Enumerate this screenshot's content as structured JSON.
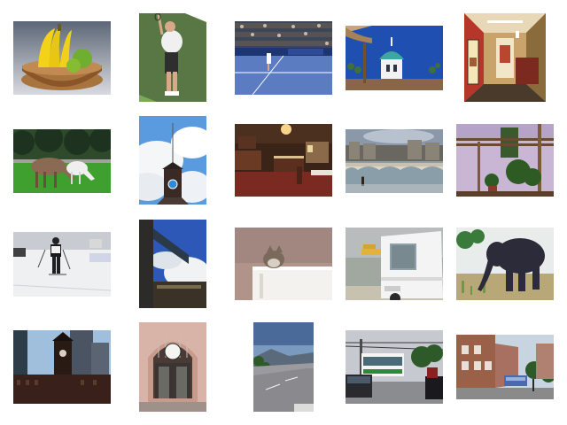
{
  "gallery": {
    "columns": 5,
    "rows": 4,
    "background": "#ffffff",
    "thumbnails": [
      {
        "subject": "banana-fruit-bowl"
      },
      {
        "subject": "tennis-player-serve"
      },
      {
        "subject": "tennis-match-arena"
      },
      {
        "subject": "gazebo-blue-sky"
      },
      {
        "subject": "train-dining-car"
      },
      {
        "subject": "horses-grazing"
      },
      {
        "subject": "clock-tower-clouds"
      },
      {
        "subject": "kitchen-interior"
      },
      {
        "subject": "river-bridge-city"
      },
      {
        "subject": "garden-pergola"
      },
      {
        "subject": "cross-country-skier"
      },
      {
        "subject": "street-sign-sky"
      },
      {
        "subject": "cat-on-cabinet"
      },
      {
        "subject": "truck-waterfront"
      },
      {
        "subject": "elephant-grass"
      },
      {
        "subject": "brick-clock-tower-skyline"
      },
      {
        "subject": "station-clock-facade"
      },
      {
        "subject": "mountain-road-view"
      },
      {
        "subject": "street-traffic-bus"
      },
      {
        "subject": "townhouse-street-bus"
      }
    ]
  }
}
